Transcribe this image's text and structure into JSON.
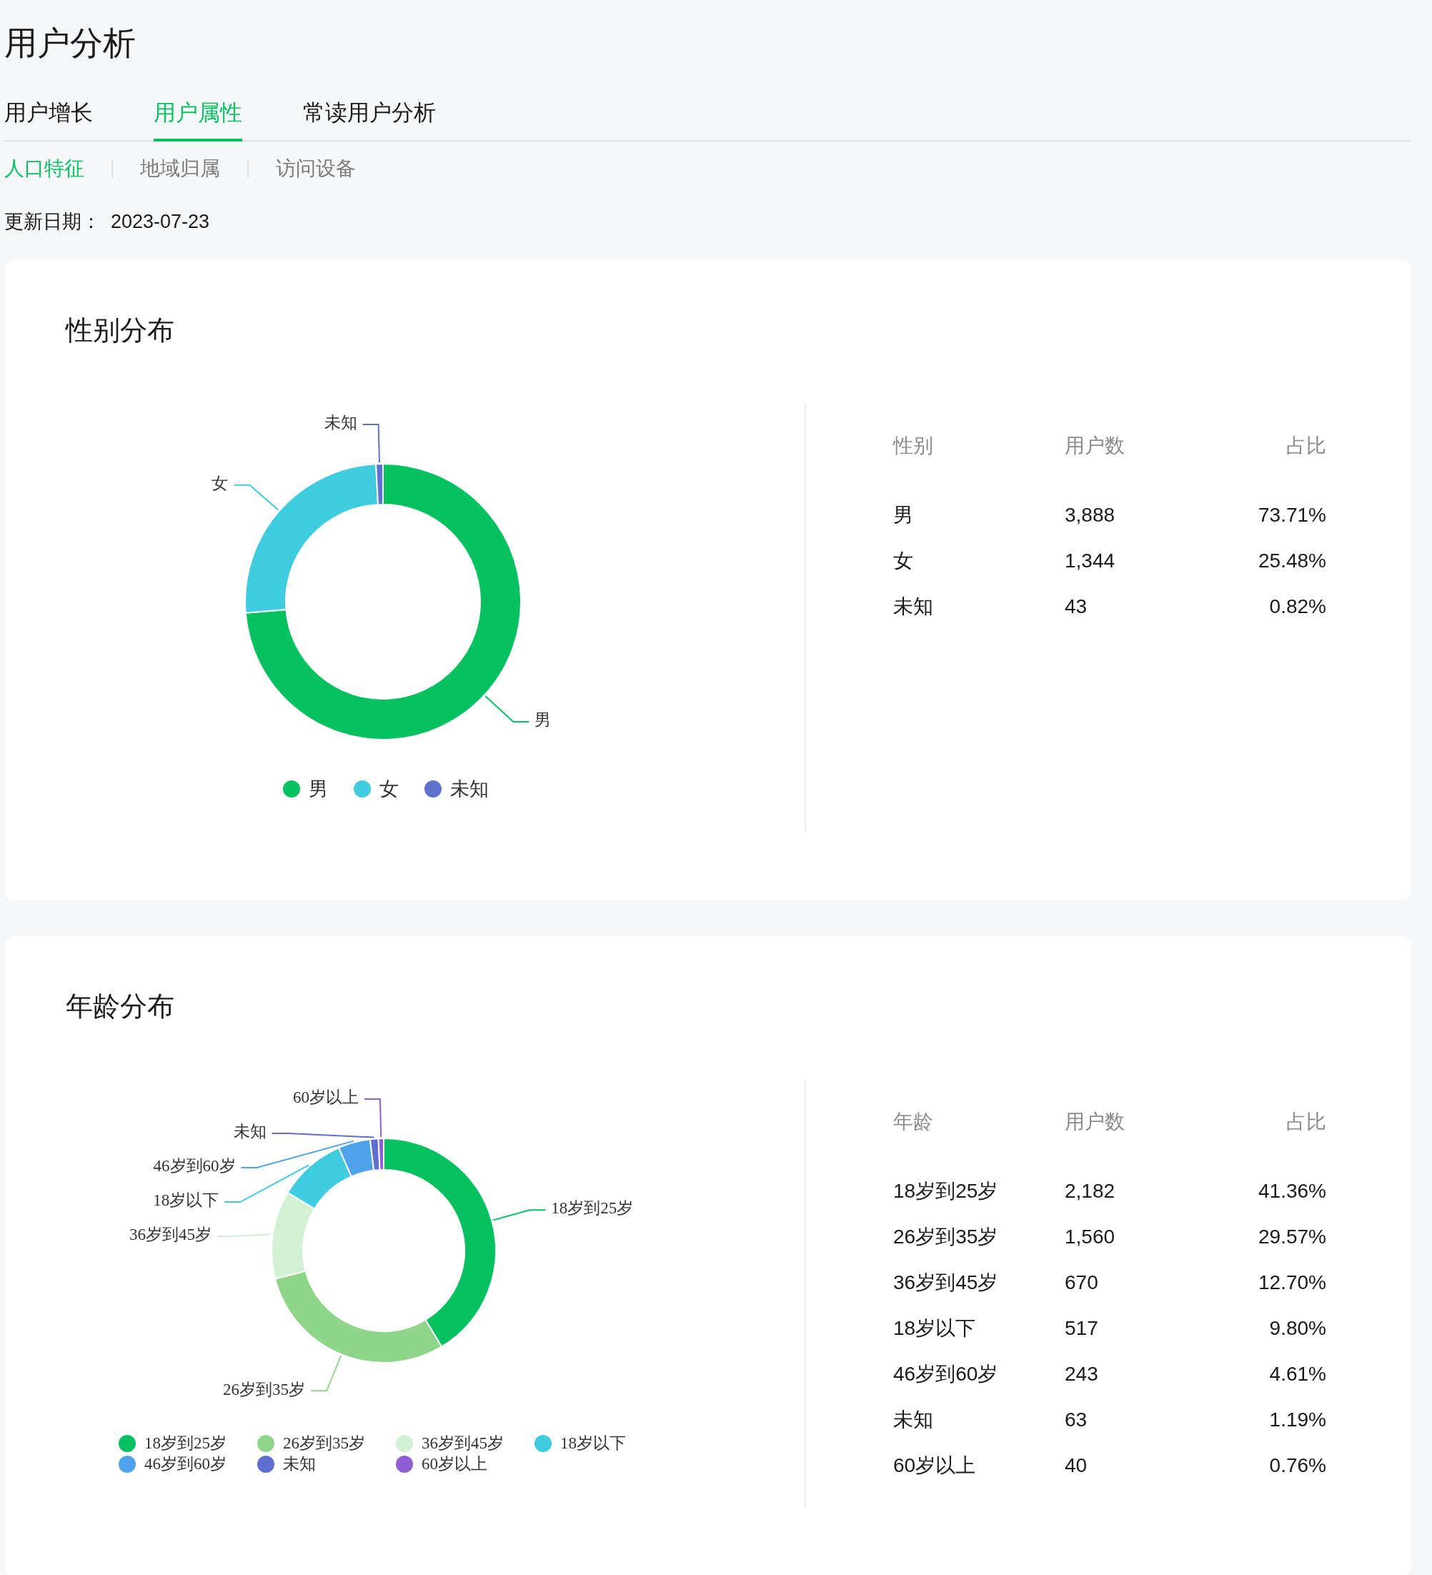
{
  "page": {
    "title": "用户分析"
  },
  "tabs": [
    {
      "label": "用户增长",
      "selected": false
    },
    {
      "label": "用户属性",
      "selected": true
    },
    {
      "label": "常读用户分析",
      "selected": false
    }
  ],
  "sub_tabs": [
    {
      "label": "人口特征",
      "selected": true
    },
    {
      "label": "地域归属",
      "selected": false
    },
    {
      "label": "访问设备",
      "selected": false
    }
  ],
  "update": {
    "label": "更新日期：",
    "value": "2023-07-23"
  },
  "sections": [
    {
      "title": "性别分布",
      "chart_data": {
        "type": "donut",
        "categories": [
          "男",
          "女",
          "未知"
        ],
        "series": [
          {
            "values": [
              73.71,
              25.48,
              0.82
            ]
          }
        ]
      },
      "legend": [
        {
          "label": "男",
          "color": "#07c160"
        },
        {
          "label": "女",
          "color": "#3fcbe0"
        },
        {
          "label": "未知",
          "color": "#5e72cf"
        }
      ],
      "table": {
        "columns": [
          "性别",
          "用户数",
          "占比"
        ],
        "rows": [
          [
            "男",
            "3,888",
            "73.71%"
          ],
          [
            "女",
            "1,344",
            "25.48%"
          ],
          [
            "未知",
            "43",
            "0.82%"
          ]
        ]
      }
    },
    {
      "title": "年龄分布",
      "chart_data": {
        "type": "donut",
        "categories": [
          "18岁到25岁",
          "26岁到35岁",
          "36岁到45岁",
          "18岁以下",
          "46岁到60岁",
          "未知",
          "60岁以上"
        ],
        "series": [
          {
            "values": [
              41.36,
              29.57,
              12.7,
              9.8,
              4.61,
              1.19,
              0.76
            ]
          }
        ]
      },
      "legend": [
        {
          "label": "18岁到25岁",
          "color": "#07c160"
        },
        {
          "label": "26岁到35岁",
          "color": "#8fd68a"
        },
        {
          "label": "36岁到45岁",
          "color": "#d2f0d2"
        },
        {
          "label": "18岁以下",
          "color": "#3fcbe0"
        },
        {
          "label": "46岁到60岁",
          "color": "#4fa3ea"
        },
        {
          "label": "未知",
          "color": "#5e6fcf"
        },
        {
          "label": "60岁以上",
          "color": "#8e5ed4"
        }
      ],
      "table": {
        "columns": [
          "年龄",
          "用户数",
          "占比"
        ],
        "rows": [
          [
            "18岁到25岁",
            "2,182",
            "41.36%"
          ],
          [
            "26岁到35岁",
            "1,560",
            "29.57%"
          ],
          [
            "36岁到45岁",
            "670",
            "12.70%"
          ],
          [
            "18岁以下",
            "517",
            "9.80%"
          ],
          [
            "46岁到60岁",
            "243",
            "4.61%"
          ],
          [
            "未知",
            "63",
            "1.19%"
          ],
          [
            "60岁以上",
            "40",
            "0.76%"
          ]
        ]
      }
    }
  ]
}
